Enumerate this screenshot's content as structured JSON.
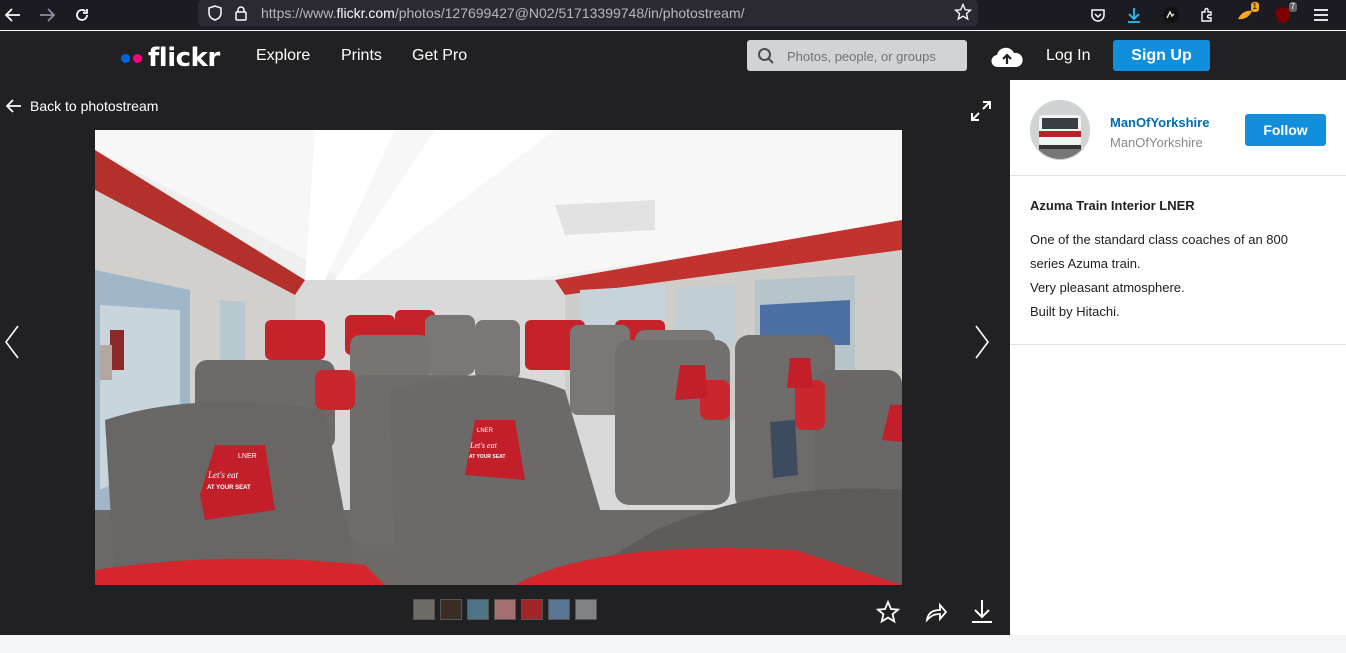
{
  "browser": {
    "url_prefix": "https://www.",
    "url_host": "flickr.com",
    "url_path": "/photos/127699427@N02/51713399748/in/photostream/"
  },
  "header": {
    "logo_text": "flickr",
    "nav": [
      "Explore",
      "Prints",
      "Get Pro"
    ],
    "search_placeholder": "Photos, people, or groups",
    "login_label": "Log In",
    "signup_label": "Sign Up",
    "colors": {
      "logo_blue": "#0063dc",
      "logo_pink": "#ff0084",
      "accent": "#128fdc"
    }
  },
  "viewer": {
    "back_label": "Back to photostream",
    "thumbnail_count": 7
  },
  "owner": {
    "display_name": "ManOfYorkshire",
    "username": "ManOfYorkshire",
    "follow_label": "Follow"
  },
  "photo": {
    "title": "Azuma Train Interior LNER",
    "description": [
      "One of the standard class coaches of an 800",
      "series Azuma train.",
      "Very pleasant atmosphere.",
      "Built by Hitachi."
    ],
    "seat_brand": "LNER",
    "seat_slogan": "Let's eat",
    "seat_slogan2": "AT YOUR SEAT"
  }
}
